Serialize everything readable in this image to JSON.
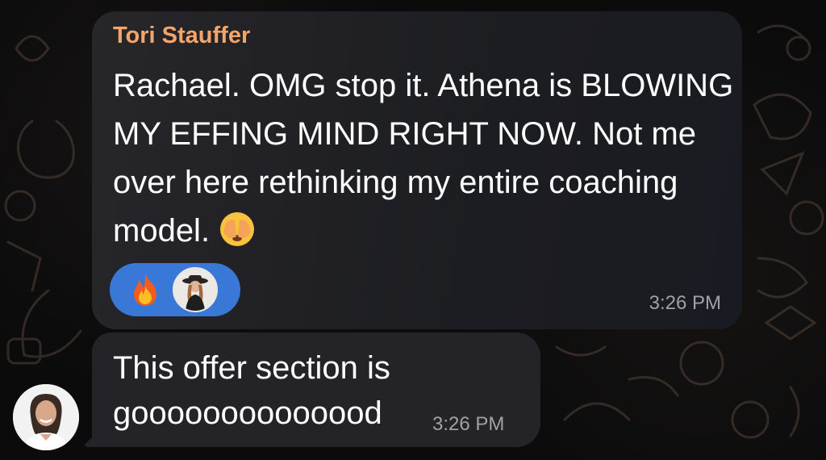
{
  "messages": [
    {
      "sender": "Tori Stauffer",
      "text": "Rachael. OMG stop it. Athena is BLOWING MY EFFING MIND RIGHT NOW. Not me over here rethinking my entire coaching model.",
      "emoji": "face-with-hand-over-eyes",
      "reaction_emoji": "🔥",
      "time": "3:26 PM"
    },
    {
      "text": "This offer section is goooooooooooood",
      "time": "3:26 PM"
    }
  ],
  "colors": {
    "sender_name": "#f3a56c",
    "reaction_pill": "#3a78d8",
    "bubble": "#242428",
    "timestamp": "#a0a0a6"
  }
}
